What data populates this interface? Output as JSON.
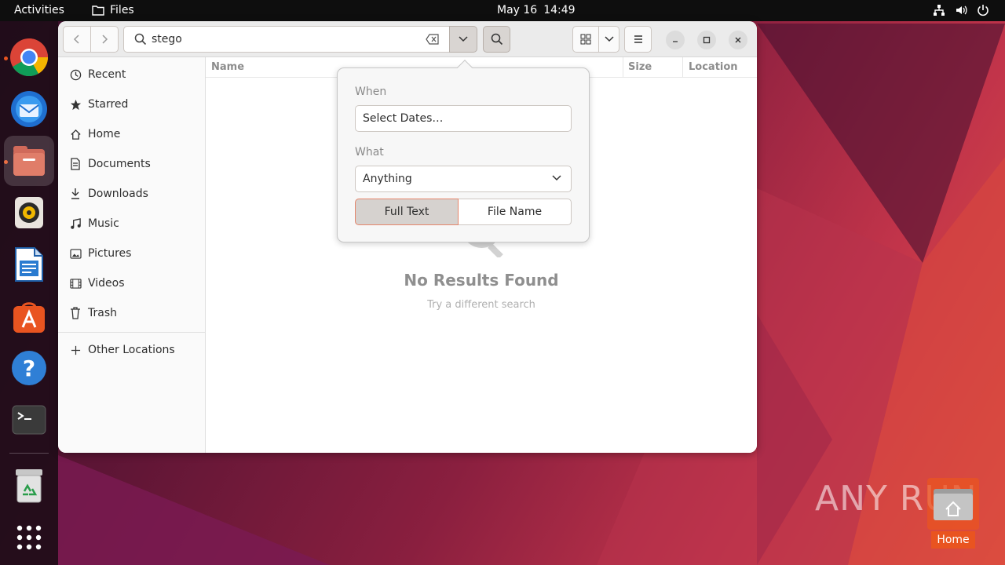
{
  "topbar": {
    "activities": "Activities",
    "app_name": "Files",
    "date": "May 16",
    "time": "14:49"
  },
  "dock": {
    "items": [
      "chrome-icon",
      "thunderbird-icon",
      "files-icon",
      "rhythmbox-icon",
      "libreoffice-writer-icon",
      "app-center-icon",
      "help-icon",
      "terminal-icon",
      "trash-icon",
      "show-apps-icon"
    ]
  },
  "window": {
    "search": {
      "value": "stego"
    },
    "sidebar": {
      "items": [
        {
          "label": "Recent",
          "icon": "clock-icon"
        },
        {
          "label": "Starred",
          "icon": "star-icon"
        },
        {
          "label": "Home",
          "icon": "home-icon"
        },
        {
          "label": "Documents",
          "icon": "document-icon"
        },
        {
          "label": "Downloads",
          "icon": "download-icon"
        },
        {
          "label": "Music",
          "icon": "music-icon"
        },
        {
          "label": "Pictures",
          "icon": "picture-icon"
        },
        {
          "label": "Videos",
          "icon": "video-icon"
        },
        {
          "label": "Trash",
          "icon": "trash-icon"
        }
      ],
      "other_locations": "Other Locations"
    },
    "columns": {
      "name": "Name",
      "size": "Size",
      "location": "Location"
    },
    "empty": {
      "title": "No Results Found",
      "subtitle": "Try a different search"
    }
  },
  "popover": {
    "when_label": "When",
    "when_value": "Select Dates…",
    "what_label": "What",
    "what_value": "Anything",
    "full_text": "Full Text",
    "file_name": "File Name"
  },
  "desktop": {
    "home_label": "Home",
    "watermark": "ANY RUN"
  },
  "colors": {
    "accent": "#e95420",
    "topbar": "#0e0e0e"
  }
}
